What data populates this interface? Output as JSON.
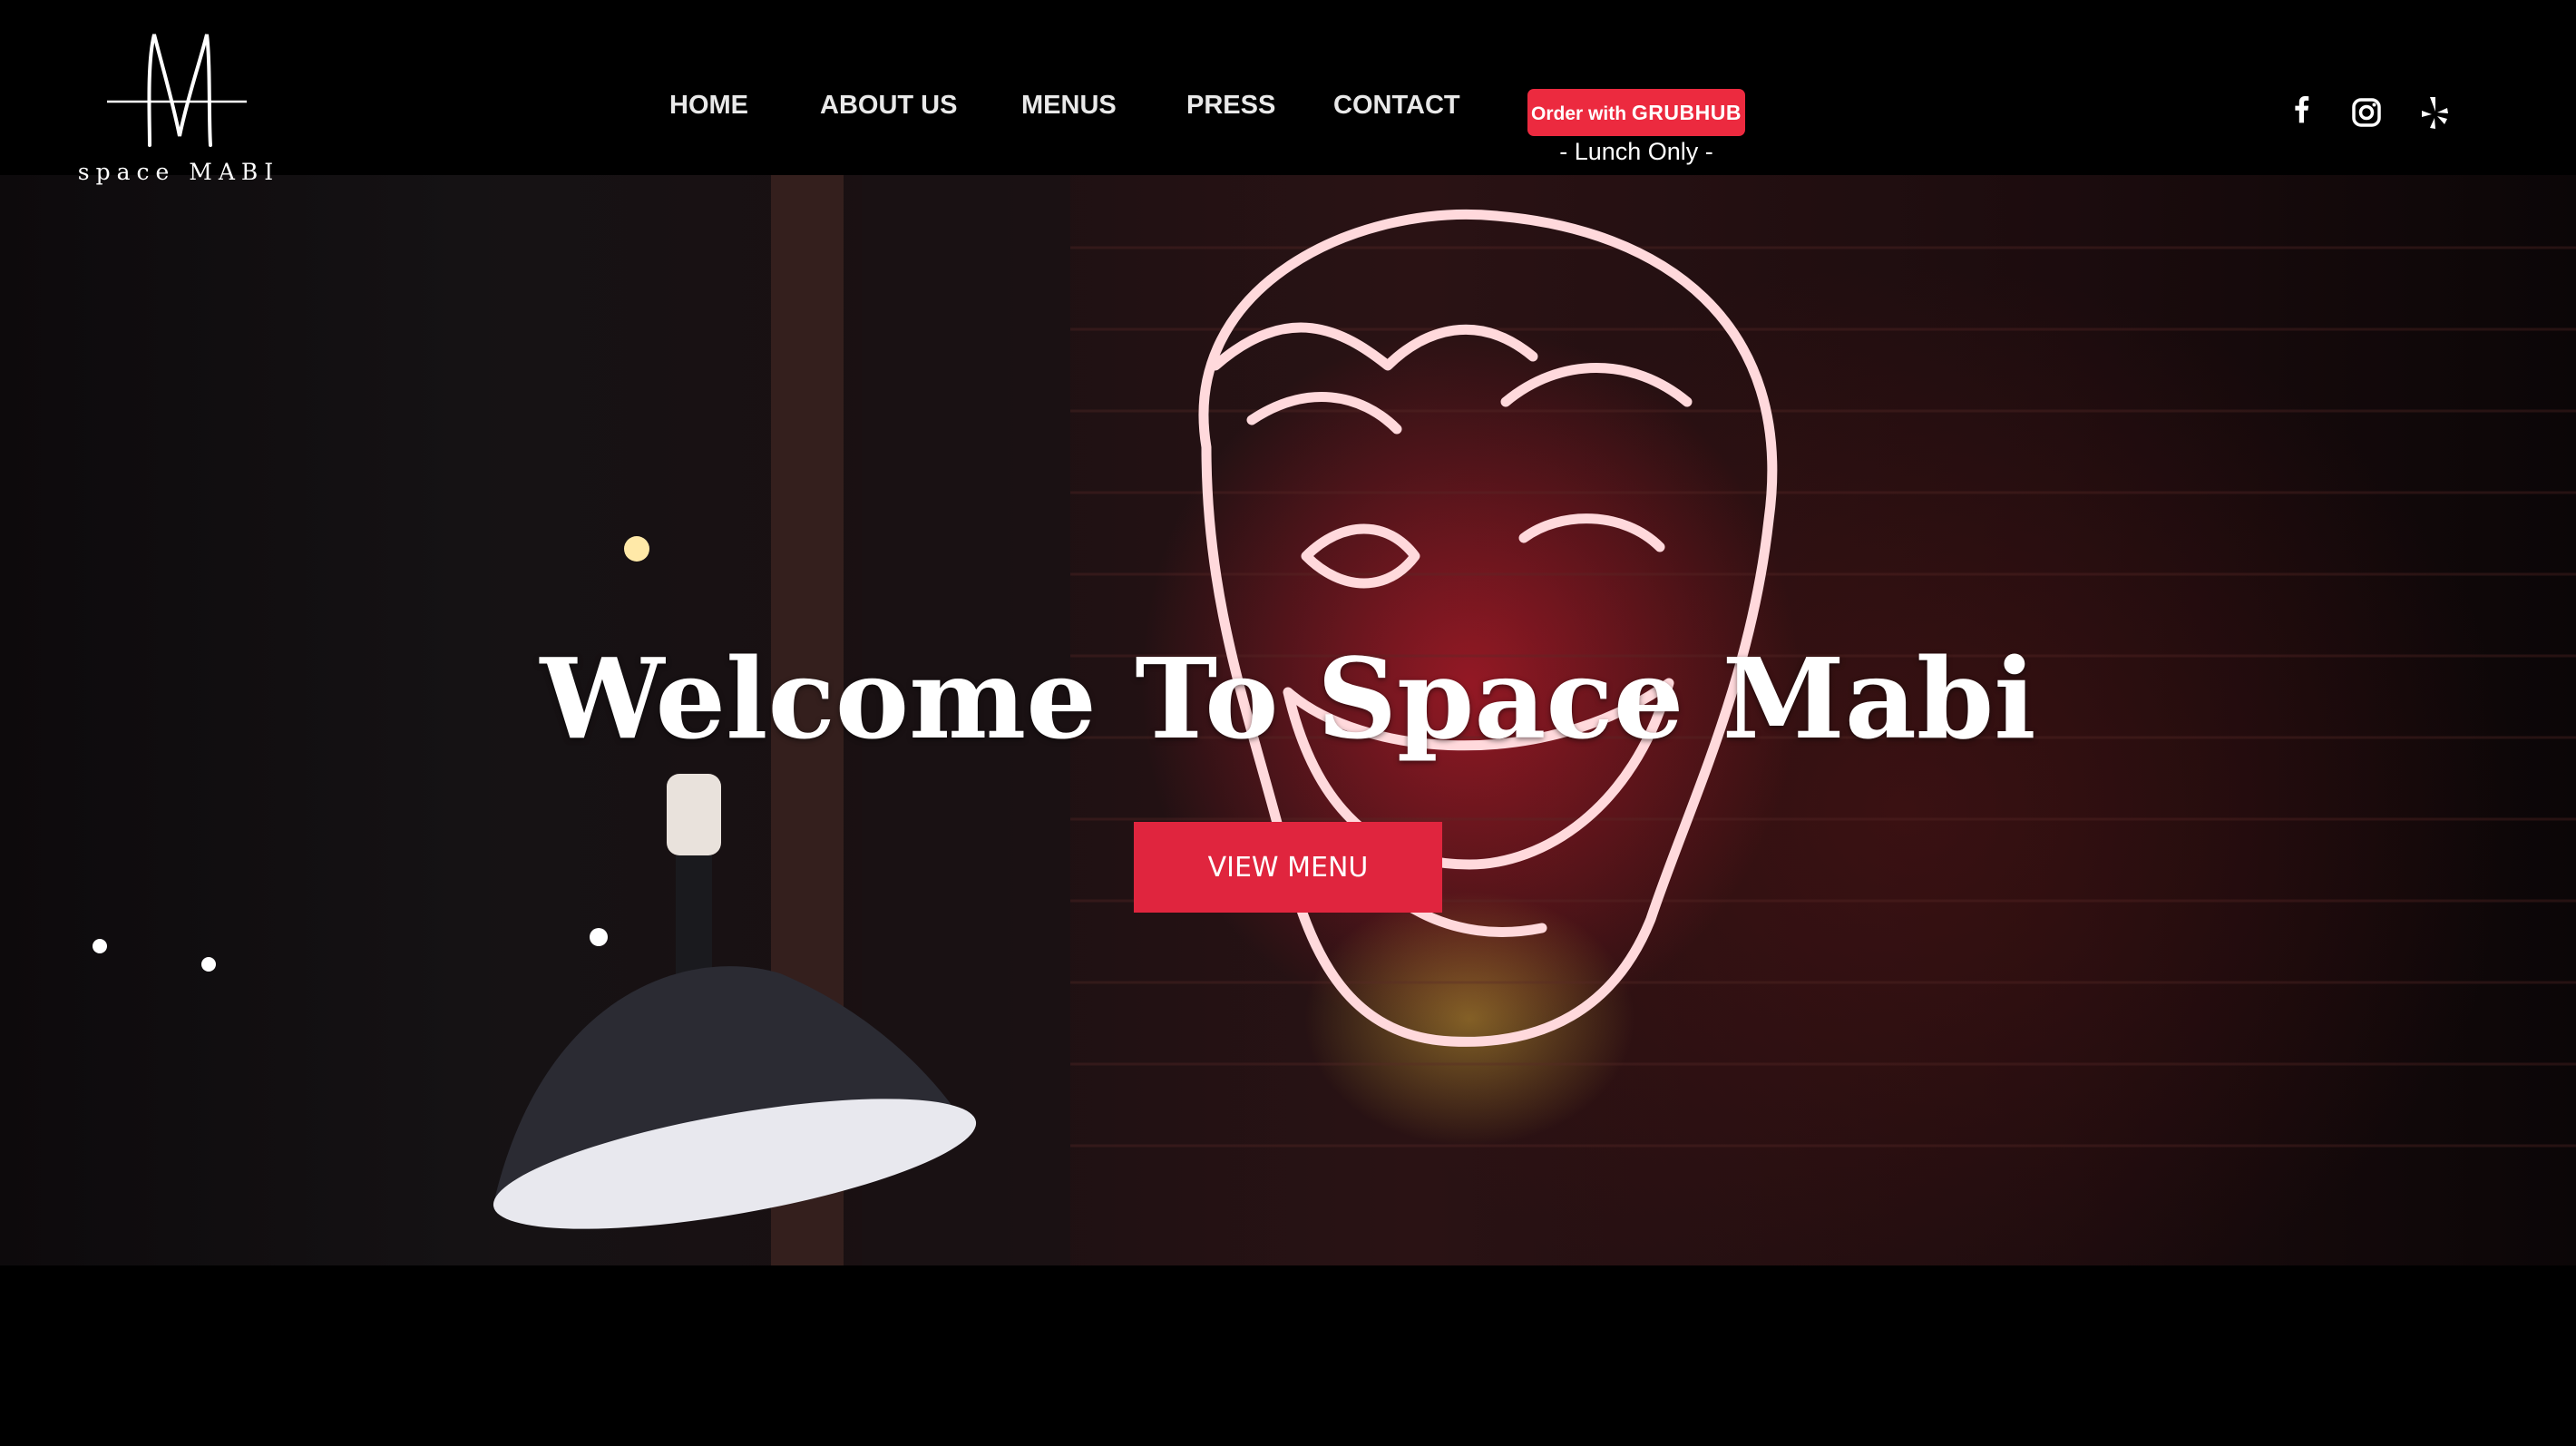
{
  "brand": {
    "logo_text": "space MABI"
  },
  "nav": {
    "items": [
      {
        "label": "HOME"
      },
      {
        "label": "ABOUT US"
      },
      {
        "label": "MENUS"
      },
      {
        "label": "PRESS"
      },
      {
        "label": "CONTACT"
      }
    ]
  },
  "order": {
    "prefix": "Order with",
    "brand": "GRUBHUB",
    "note": "- Lunch Only -",
    "color": "#ec2a3f"
  },
  "social": [
    {
      "icon": "facebook-icon"
    },
    {
      "icon": "instagram-icon"
    },
    {
      "icon": "yelp-icon"
    }
  ],
  "hero": {
    "title": "Welcome To Space Mabi",
    "button_label": "VIEW MENU",
    "button_color": "#e0253e"
  }
}
